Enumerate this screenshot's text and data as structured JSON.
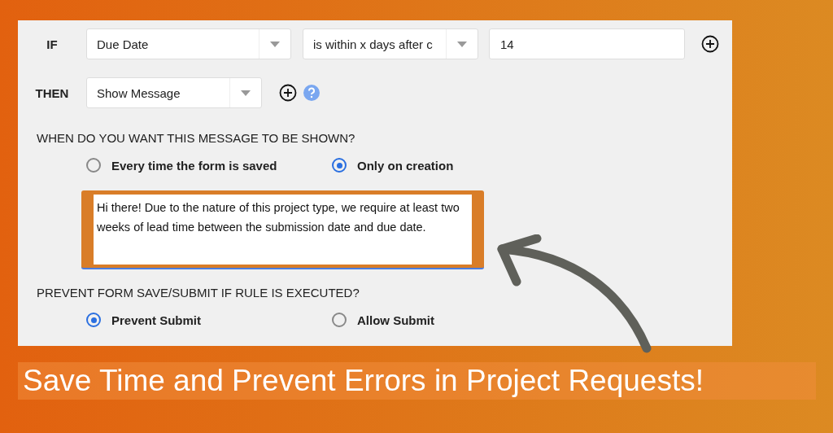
{
  "condition": {
    "label": "IF",
    "field": {
      "value": "Due Date"
    },
    "operator": {
      "value": "is within x days after c"
    },
    "amount": {
      "value": "14"
    }
  },
  "action": {
    "label": "THEN",
    "select": {
      "value": "Show Message"
    }
  },
  "display_question": {
    "text": "WHEN DO YOU WANT THIS MESSAGE TO BE SHOWN?",
    "options": [
      {
        "label": "Every time the form is saved",
        "selected": false
      },
      {
        "label": "Only on creation",
        "selected": true
      }
    ]
  },
  "message": {
    "value": "Hi there! Due to the nature of this project type, we require at least two weeks of lead time between the submission date and due date.",
    "highlighted": true
  },
  "prevent_question": {
    "text": "PREVENT FORM SAVE/SUBMIT IF RULE IS EXECUTED?",
    "options": [
      {
        "label": "Prevent Submit",
        "selected": true
      },
      {
        "label": "Allow Submit",
        "selected": false
      }
    ]
  },
  "banner": {
    "text": "Save Time and Prevent Errors in Project Requests!"
  }
}
